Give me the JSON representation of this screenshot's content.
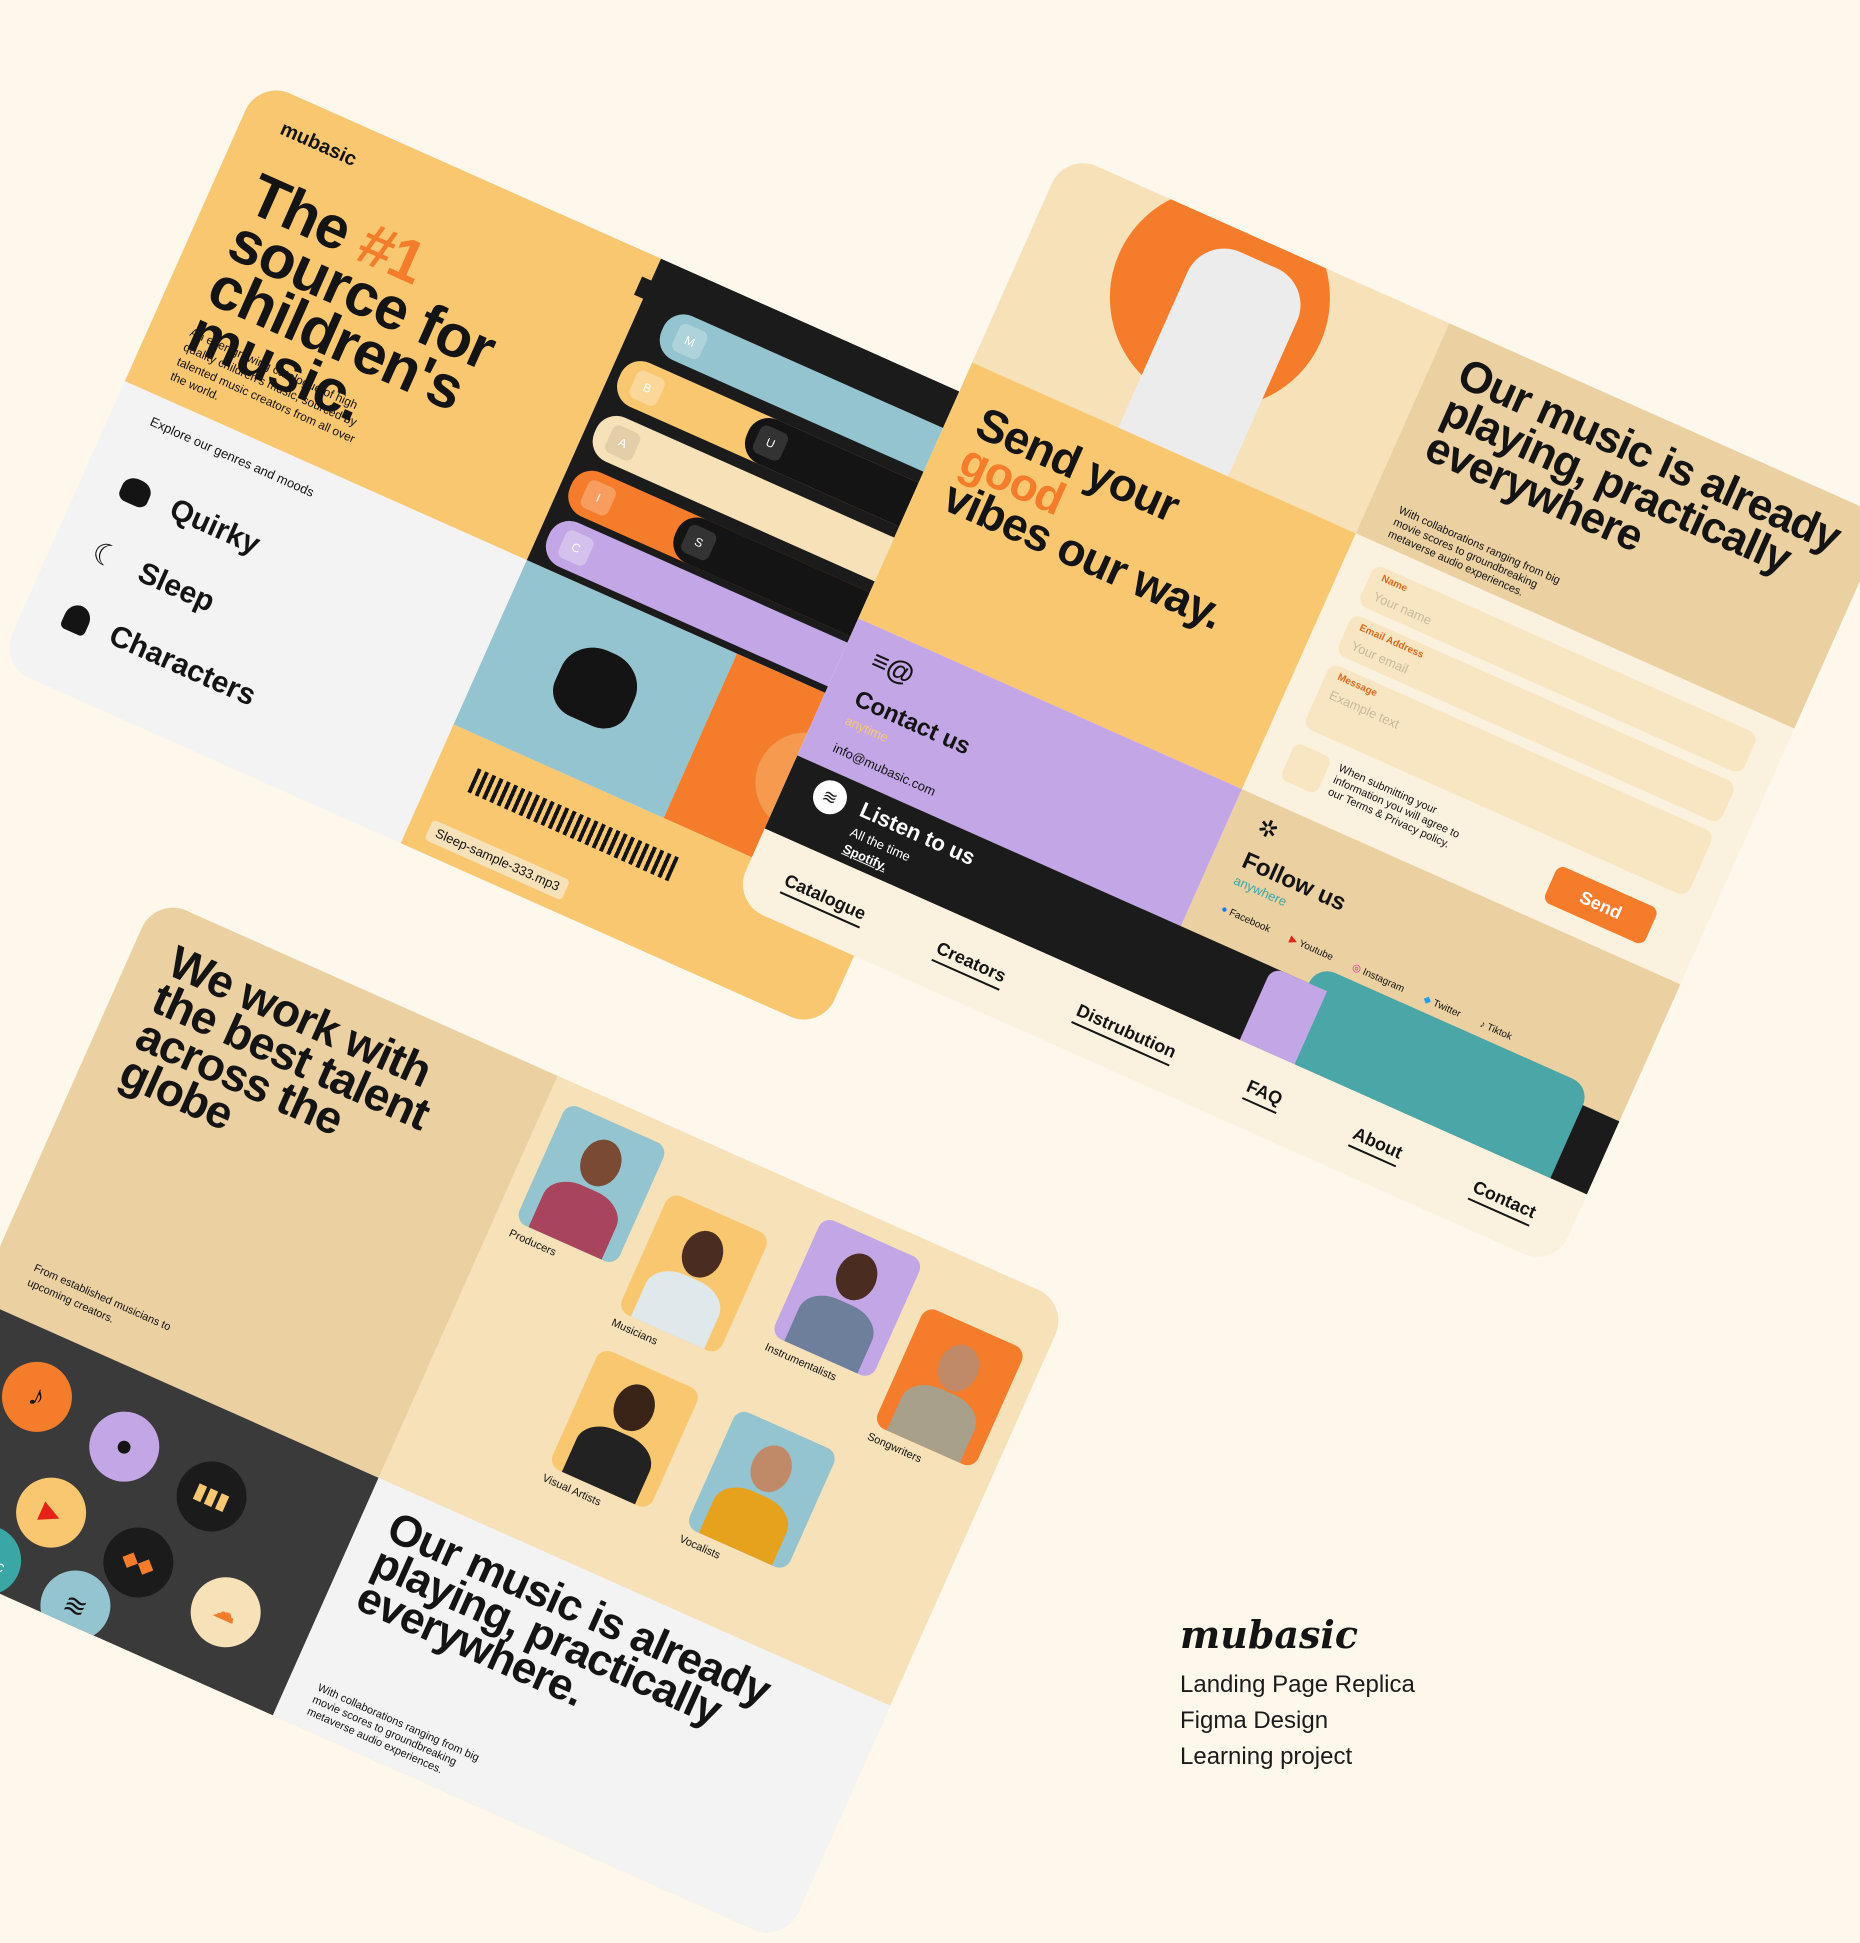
{
  "board1": {
    "logo": "mubasic",
    "title_pre": "The ",
    "title_accent": "#1",
    "title_post": "source for children's music.",
    "description": "An ever-growing catalogue of high quality children's music, sourced by talented music creators from all over the world.",
    "explore_label": "Explore our genres and moods",
    "genres": [
      "Quirky",
      "Sleep",
      "Characters"
    ],
    "bar_letters": [
      "M",
      "U",
      "B",
      "A",
      "S",
      "I",
      "C"
    ],
    "file_name": "Sleep-sample-333.mp3"
  },
  "board2": {
    "title": "Our music is already playing, practically everywhere",
    "blurb": "With collaborations ranging from big movie scores to groundbreaking metaverse audio experiences.",
    "send_title_1": "Send your",
    "send_title_accent": "good",
    "send_title_2": "vibes our way.",
    "form": {
      "name_label": "Name",
      "name_placeholder": "Your name",
      "email_label": "Email Address",
      "email_placeholder": "Your email",
      "message_label": "Message",
      "message_placeholder": "Example text",
      "consent": "When submitting your information you will agree to our Terms & Privacy policy.",
      "send_label": "Send"
    },
    "contact": {
      "title": "Contact us",
      "sub": "anytime",
      "email": "info@mubasic.com"
    },
    "listen": {
      "title": "Listen to us",
      "sub": "All the time",
      "link": "Spotify."
    },
    "follow": {
      "title": "Follow us",
      "sub": "anywhere",
      "links": [
        "Facebook",
        "Youtube",
        "Instagram",
        "Twitter",
        "Tiktok"
      ]
    },
    "nav": [
      "Catalogue",
      "Creators",
      "Distrubution",
      "FAQ",
      "About",
      "Contact"
    ]
  },
  "board3": {
    "title": "We work with the best talent across the globe",
    "sub": "From established musicians to upcoming creators.",
    "talent": [
      "Producers",
      "Musicians",
      "Instrumentalists",
      "Songwriters",
      "Visual Artists",
      "Vocalists"
    ],
    "platform_icons": [
      "tiktok-icon",
      "apple-music-icon",
      "deezer-icon",
      "shazam-icon",
      "youtube-icon",
      "tidal-icon",
      "soundcloud-icon",
      "amazon-music-icon",
      "spotify-icon"
    ],
    "platform_music_text": "music",
    "bottom_title": "Our music is already playing, practically everywhere.",
    "bottom_blurb": "With collaborations ranging from big movie scores to groundbreaking metaverse audio experiences."
  },
  "caption": {
    "logo": "mubasic",
    "lines": [
      "Landing Page Replica",
      "Figma Design",
      "Learning project"
    ]
  },
  "colors": {
    "background": "#fdf7ec",
    "yellow": "#f9c76f",
    "orange": "#f47c2a",
    "blue": "#94c4cf",
    "purple": "#c3a6e6",
    "dark": "#1b1b1b",
    "beige": "#ebd0a2"
  }
}
